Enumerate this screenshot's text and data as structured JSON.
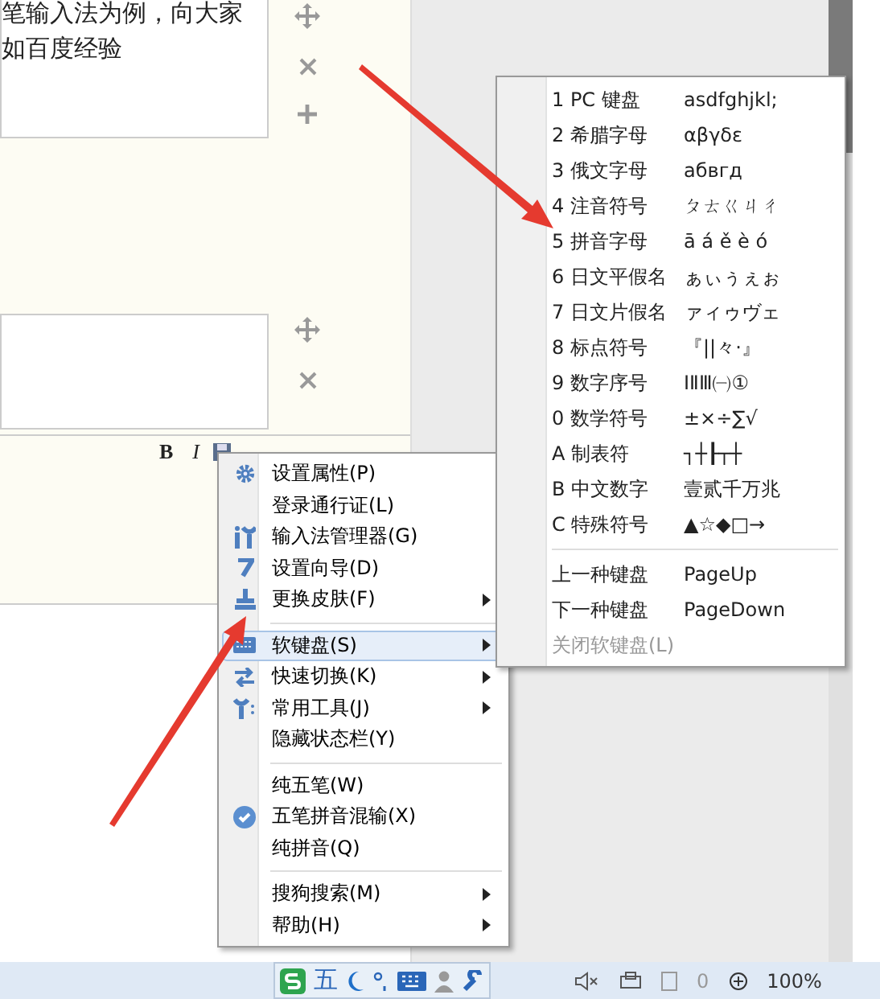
{
  "editor": {
    "blocks": [
      {
        "lines": [
          "笔输入法为例，向大家",
          "如百度经验"
        ]
      }
    ],
    "format_toolbar": [
      "B",
      "I"
    ]
  },
  "context_menu": {
    "sections": [
      [
        {
          "label": "设置属性(P)",
          "submenu": false,
          "selected": false,
          "checked": false
        },
        {
          "label": "登录通行证(L)",
          "submenu": false,
          "selected": false,
          "checked": false
        },
        {
          "label": "输入法管理器(G)",
          "submenu": false,
          "selected": false,
          "checked": false
        },
        {
          "label": "设置向导(D)",
          "submenu": false,
          "selected": false,
          "checked": false
        },
        {
          "label": "更换皮肤(F)",
          "submenu": true,
          "selected": false,
          "checked": false
        }
      ],
      [
        {
          "label": "软键盘(S)",
          "submenu": true,
          "selected": true,
          "checked": false
        },
        {
          "label": "快速切换(K)",
          "submenu": true,
          "selected": false,
          "checked": false
        },
        {
          "label": "常用工具(J)",
          "submenu": true,
          "selected": false,
          "checked": false
        },
        {
          "label": "隐藏状态栏(Y)",
          "submenu": false,
          "selected": false,
          "checked": false
        }
      ],
      [
        {
          "label": "纯五笔(W)",
          "submenu": false,
          "selected": false,
          "checked": false
        },
        {
          "label": "五笔拼音混输(X)",
          "submenu": false,
          "selected": false,
          "checked": true
        },
        {
          "label": "纯拼音(Q)",
          "submenu": false,
          "selected": false,
          "checked": false
        }
      ],
      [
        {
          "label": "搜狗搜索(M)",
          "submenu": true,
          "selected": false,
          "checked": false
        },
        {
          "label": "帮助(H)",
          "submenu": true,
          "selected": false,
          "checked": false
        }
      ]
    ]
  },
  "soft_keyboard_menu": {
    "keyboards": [
      {
        "name": "1 PC 键盘",
        "sample": "asdfghjkl;"
      },
      {
        "name": "2 希腊字母",
        "sample": "αβγδε"
      },
      {
        "name": "3 俄文字母",
        "sample": "абвгд"
      },
      {
        "name": "4 注音符号",
        "sample": "ㄆㄊㄍㄐㄔ"
      },
      {
        "name": "5 拼音字母",
        "sample": "ā á ě è ó"
      },
      {
        "name": "6 日文平假名",
        "sample": "ぁぃぅぇぉ"
      },
      {
        "name": "7 日文片假名",
        "sample": "ァィゥヴェ"
      },
      {
        "name": "8 标点符号",
        "sample": "『||々·』"
      },
      {
        "name": "9 数字序号",
        "sample": "ⅠⅡⅢ㈠①"
      },
      {
        "name": "0 数学符号",
        "sample": "±×÷∑√"
      },
      {
        "name": "A 制表符",
        "sample": "┐┼┠┬┼"
      },
      {
        "name": "B 中文数字",
        "sample": "壹贰千万兆"
      },
      {
        "name": "C 特殊符号",
        "sample": "▲☆◆□→"
      }
    ],
    "navigation": [
      {
        "label": "上一种键盘",
        "shortcut": "PageUp"
      },
      {
        "label": "下一种键盘",
        "shortcut": "PageDown"
      }
    ],
    "close": {
      "label": "关闭软键盘(L)",
      "disabled": true
    }
  },
  "status_bar": {
    "ime_mode": "五",
    "zoom": "100%",
    "count": "0"
  }
}
